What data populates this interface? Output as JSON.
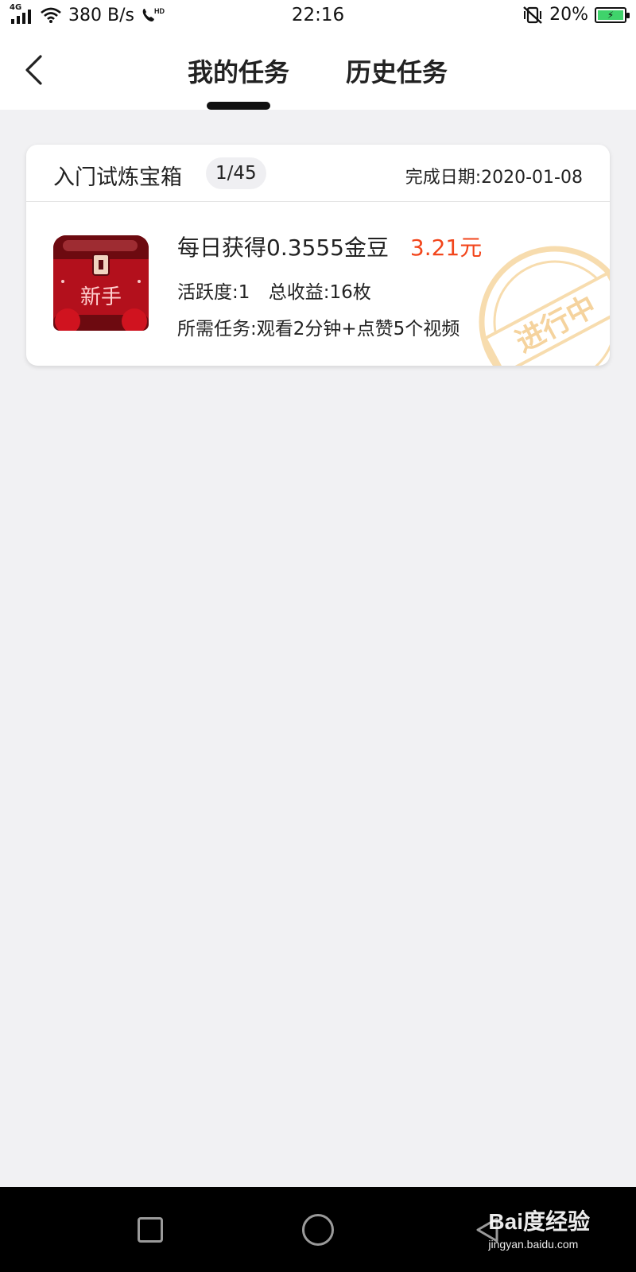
{
  "status_bar": {
    "network": "4G",
    "speed": "380 B/s",
    "hd": "HD",
    "time": "22:16",
    "battery_percent": "20%",
    "battery_level": 0.2
  },
  "top_nav": {
    "tabs": [
      {
        "label": "我的任务",
        "active": true
      },
      {
        "label": "历史任务",
        "active": false
      }
    ]
  },
  "task_card": {
    "title": "入门试炼宝箱",
    "progress": "1/45",
    "due_date": "完成日期:2020-01-08",
    "chest_label": "新手",
    "daily_reward": "每日获得0.3555金豆",
    "amount": "3.21元",
    "activity": "活跃度:1",
    "total_income": "总收益:16枚",
    "requirement": "所需任务:观看2分钟+点赞5个视频",
    "stamp_text": "进行中"
  },
  "watermark": {
    "brand": "Bai度经验",
    "url": "jingyan.baidu.com"
  },
  "colors": {
    "accent": "#f2461c",
    "background": "#f1f1f3",
    "stamp": "#f7d9a6",
    "chest_red": "#b3101c"
  }
}
